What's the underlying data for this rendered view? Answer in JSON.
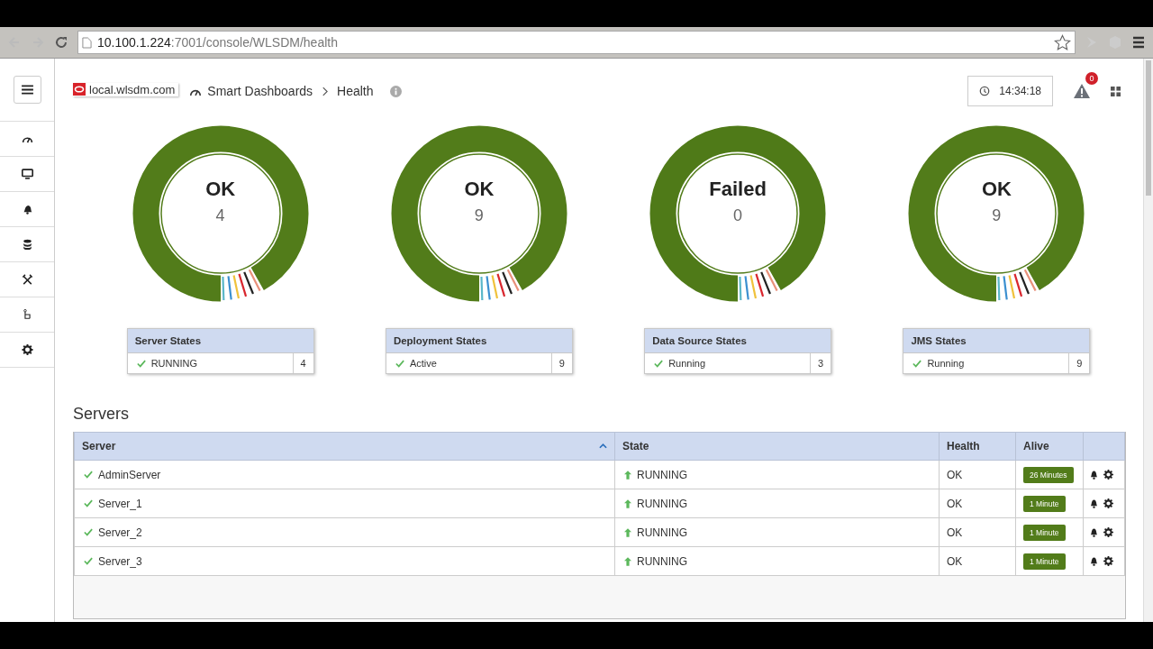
{
  "browser": {
    "host": "10.100.1.224",
    "path": ":7001/console/WLSDM/health"
  },
  "breadcrumb": {
    "domain": "local.wlsdm.com",
    "items": [
      "Smart Dashboards",
      "Health"
    ]
  },
  "clock": "14:34:18",
  "alerts": {
    "count": "0"
  },
  "gauges": [
    {
      "status": "OK",
      "count": "4",
      "card": {
        "title": "Server States",
        "rows": [
          {
            "label": "RUNNING",
            "count": "4"
          }
        ]
      }
    },
    {
      "status": "OK",
      "count": "9",
      "card": {
        "title": "Deployment States",
        "rows": [
          {
            "label": "Active",
            "count": "9"
          }
        ]
      }
    },
    {
      "status": "Failed",
      "count": "0",
      "card": {
        "title": "Data Source States",
        "rows": [
          {
            "label": "Running",
            "count": "3"
          }
        ]
      }
    },
    {
      "status": "OK",
      "count": "9",
      "card": {
        "title": "JMS States",
        "rows": [
          {
            "label": "Running",
            "count": "9"
          }
        ]
      }
    }
  ],
  "servers": {
    "title": "Servers",
    "columns": [
      "Server",
      "State",
      "Health",
      "Alive"
    ],
    "rows": [
      {
        "server": "AdminServer",
        "state": "RUNNING",
        "health": "OK",
        "alive": "26 Minutes"
      },
      {
        "server": "Server_1",
        "state": "RUNNING",
        "health": "OK",
        "alive": "1 Minute"
      },
      {
        "server": "Server_2",
        "state": "RUNNING",
        "health": "OK",
        "alive": "1 Minute"
      },
      {
        "server": "Server_3",
        "state": "RUNNING",
        "health": "OK",
        "alive": "1 Minute"
      }
    ]
  }
}
